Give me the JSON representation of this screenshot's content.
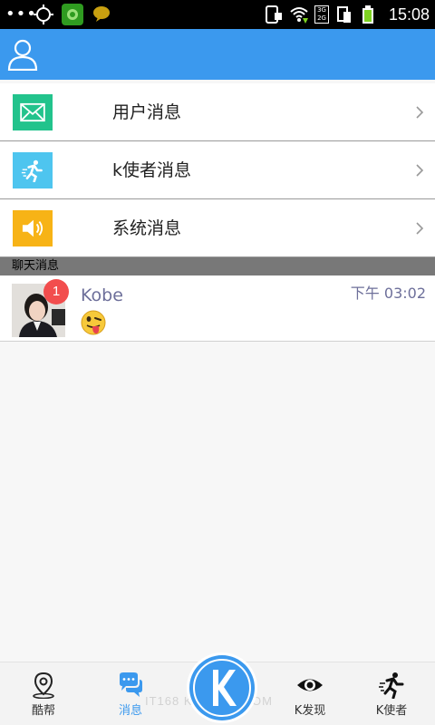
{
  "status_bar": {
    "dots": "•••",
    "network_top": "3G",
    "network_bottom": "2G",
    "time": "15:08"
  },
  "menu": [
    {
      "label": "用户消息",
      "icon": "mail-icon",
      "color": "#22c38c"
    },
    {
      "label": "k使者消息",
      "icon": "runner-icon",
      "color": "#4ec5ef"
    },
    {
      "label": "系统消息",
      "icon": "speaker-icon",
      "color": "#f7b316"
    }
  ],
  "section": {
    "title": "聊天消息"
  },
  "chat": {
    "name": "Kobe",
    "time": "下午 03:02",
    "badge": "1",
    "emoji": "tongue-out-emoji-icon"
  },
  "nav": {
    "items": [
      {
        "label": "酷帮",
        "icon": "map-pin-icon"
      },
      {
        "label": "消息",
        "icon": "chat-bubbles-icon",
        "active": true
      },
      {
        "label": "K发现",
        "icon": "eye-icon"
      },
      {
        "label": "K使者",
        "icon": "runner-icon"
      }
    ],
    "center": "K",
    "watermark": "IT168 KANGZH.COM"
  },
  "colors": {
    "app_bar": "#3b99ee",
    "accent": "#3b99ee",
    "badge": "#f24d4d"
  }
}
